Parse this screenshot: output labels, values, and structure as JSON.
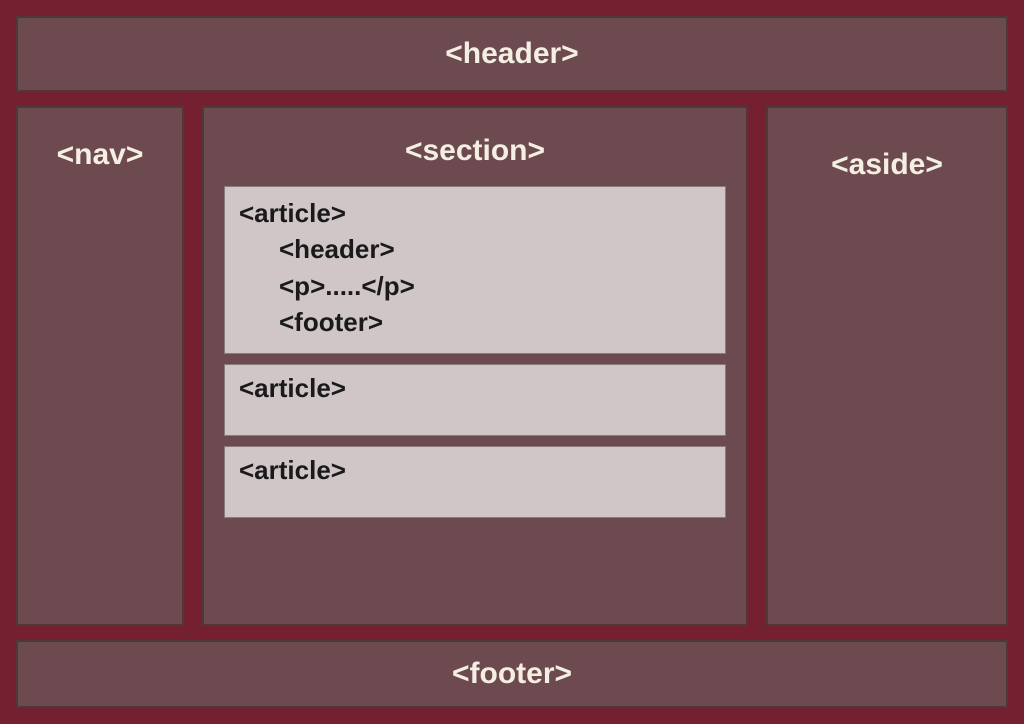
{
  "layout": {
    "header": "<header>",
    "nav": "<nav>",
    "section": "<section>",
    "aside": "<aside>",
    "footer": "<footer>"
  },
  "article1": {
    "open": "<article>",
    "header": "<header>",
    "p": "<p>.....</p>",
    "footer": "<footer>"
  },
  "article2": {
    "open": "<article>"
  },
  "article3": {
    "open": "<article>"
  }
}
